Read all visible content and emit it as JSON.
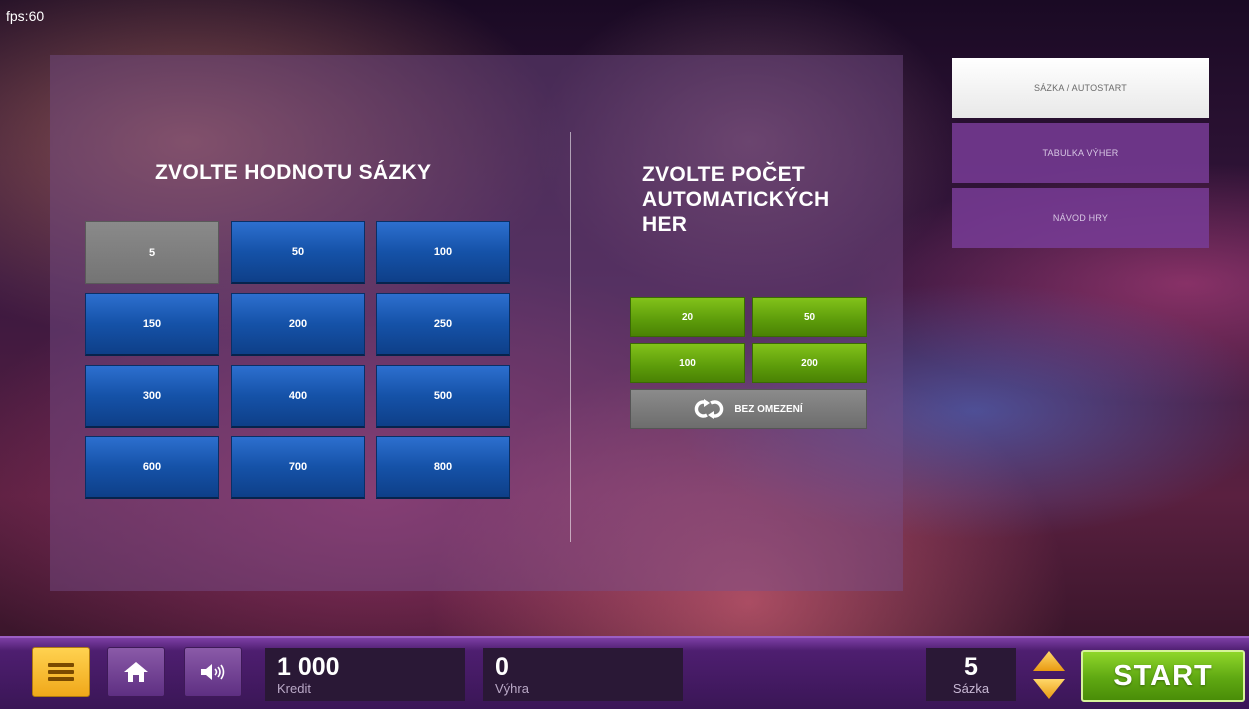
{
  "fps": "fps:60",
  "bet_section": {
    "heading": "ZVOLTE HODNOTU SÁZKY",
    "values": [
      "5",
      "50",
      "100",
      "150",
      "200",
      "250",
      "300",
      "400",
      "500",
      "600",
      "700",
      "800"
    ],
    "selected": "5"
  },
  "autoplay_section": {
    "heading": "ZVOLTE POČET AUTOMATICKÝCH HER",
    "counts": [
      "20",
      "50",
      "100",
      "200"
    ],
    "unlimited_label": "BEZ OMEZENÍ"
  },
  "side_tabs": [
    {
      "label": "SÁZKA / AUTOSTART",
      "active": true
    },
    {
      "label": "TABULKA VÝHER",
      "active": false
    },
    {
      "label": "NÁVOD HRY",
      "active": false
    }
  ],
  "bottom_bar": {
    "credit_value": "1 000",
    "credit_label": "Kredit",
    "win_value": "0",
    "win_label": "Výhra",
    "stake_value": "5",
    "stake_label": "Sázka",
    "start_label": "START"
  },
  "icons": [
    "menu-icon",
    "home-icon",
    "sound-icon",
    "loop-icon",
    "stake-arrows-icon"
  ],
  "colors": {
    "bet_button": "#1552a8",
    "selected_button": "#7e7e7e",
    "autoplay_button": "#5c9b0a",
    "active_tab": "#ffffff",
    "inactive_tab": "#7a3c96",
    "menu_button": "#f0a81a",
    "start_button": "#5fa812"
  }
}
